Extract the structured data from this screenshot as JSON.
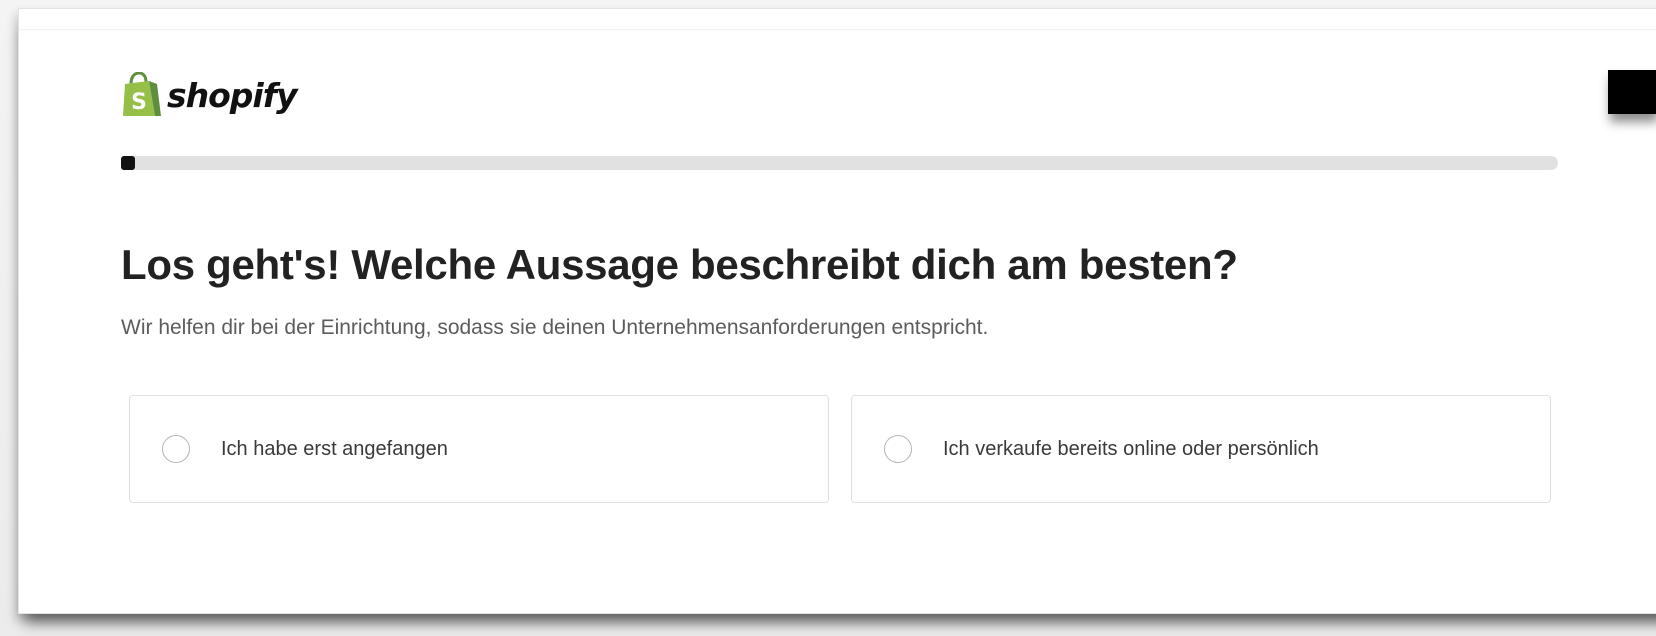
{
  "logo": {
    "wordmark": "shopify",
    "icon": "shopify-bag-icon",
    "brand_color": "#95bf47"
  },
  "progress": {
    "fraction": 0.01,
    "track_color": "#e1e1e1",
    "fill_color": "#111111"
  },
  "main": {
    "title": "Los geht's! Welche Aussage beschreibt dich am besten?",
    "subtitle": "Wir helfen dir bei der Einrichtung, sodass sie deinen Unternehmensanforderungen entspricht.",
    "options": [
      {
        "label": "Ich habe erst angefangen",
        "selected": false
      },
      {
        "label": "Ich verkaufe bereits online oder persönlich",
        "selected": false
      }
    ]
  }
}
